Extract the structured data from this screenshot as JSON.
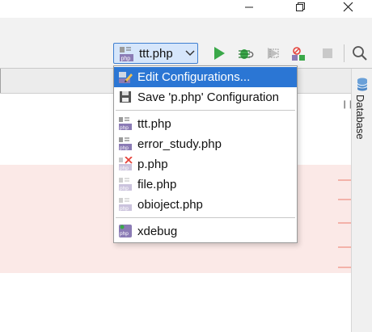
{
  "window_controls": {
    "minimize_icon": "minimize-icon",
    "restore_icon": "restore-icon",
    "close_icon": "close-icon"
  },
  "toolbar": {
    "run_config": {
      "label": "ttt.php",
      "icon": "php-file-icon",
      "dropdown_icon": "chevron-down-icon"
    },
    "buttons": [
      "run-icon",
      "debug-icon",
      "coverage-icon",
      "profile-icon",
      "stop-icon",
      "search-icon"
    ]
  },
  "side_panel": {
    "database_label": "Database"
  },
  "popup": {
    "actions": [
      {
        "label": "Edit Configurations...",
        "icon": "edit-config-icon",
        "selected": true
      },
      {
        "label": "Save 'p.php' Configuration",
        "icon": "save-icon",
        "selected": false
      }
    ],
    "configurations": [
      {
        "label": "ttt.php",
        "icon": "php-file-icon"
      },
      {
        "label": "error_study.php",
        "icon": "php-file-icon"
      },
      {
        "label": "p.php",
        "icon": "php-file-error-icon"
      },
      {
        "label": "file.php",
        "icon": "php-file-faded-icon"
      },
      {
        "label": "obioject.php",
        "icon": "php-file-faded-icon"
      }
    ],
    "extra": [
      {
        "label": "xdebug",
        "icon": "xdebug-php-icon"
      }
    ]
  },
  "colors": {
    "selection": "#2b76d4",
    "run_green": "#3aa849",
    "error_red": "#e5423a",
    "error_highlight": "#fbe9e7"
  }
}
